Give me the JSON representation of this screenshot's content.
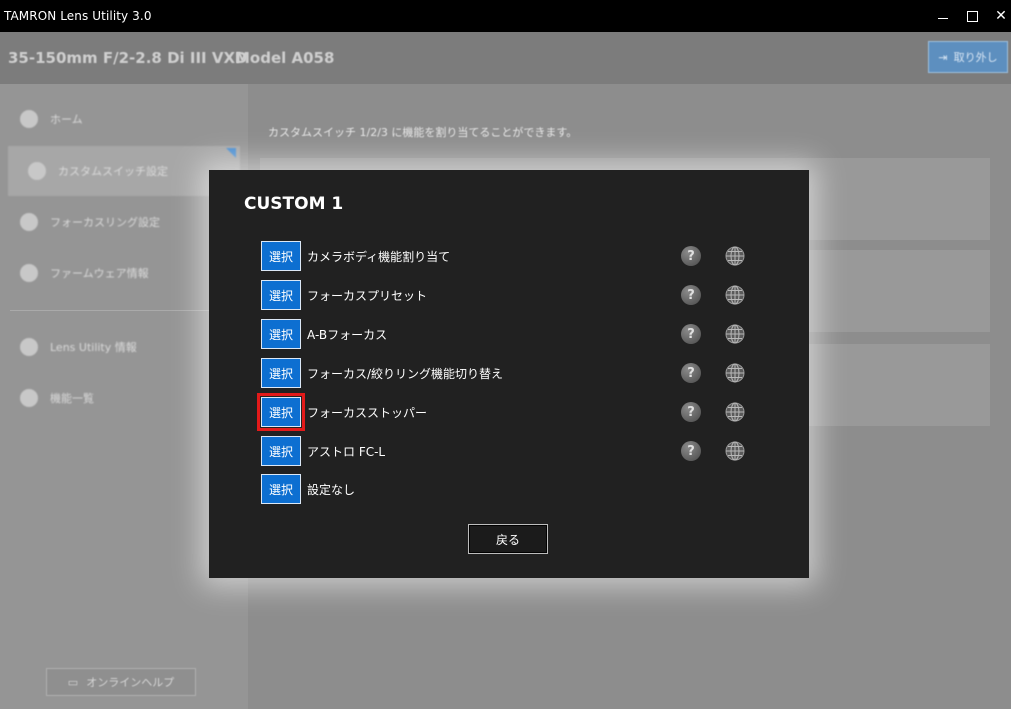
{
  "window": {
    "title": "TAMRON Lens Utility  3.0"
  },
  "header": {
    "lens_name": "35-150mm F/2-2.8 Di III VXD",
    "model": "Model A058",
    "detach_label": "取り外し"
  },
  "sidebar": {
    "items": [
      {
        "label": "ホーム",
        "icon": "home-icon"
      },
      {
        "label": "カスタムスイッチ設定",
        "icon": "switch-icon"
      },
      {
        "label": "フォーカスリング設定",
        "icon": "ring-icon"
      },
      {
        "label": "ファームウェア情報",
        "icon": "firmware-icon"
      },
      {
        "label": "Lens Utility 情報",
        "icon": "info-icon"
      },
      {
        "label": "機能一覧",
        "icon": "list-icon"
      }
    ],
    "help_label": "オンラインヘルプ"
  },
  "content": {
    "intro": "カスタムスイッチ 1/2/3 に機能を割り当てることができます。"
  },
  "modal": {
    "title": "CUSTOM 1",
    "select_label": "選択",
    "options": [
      {
        "label": "カメラボディ機能割り当て",
        "has_help": true
      },
      {
        "label": "フォーカスプリセット",
        "has_help": true
      },
      {
        "label": "A-Bフォーカス",
        "has_help": true
      },
      {
        "label": "フォーカス/絞りリング機能切り替え",
        "has_help": true
      },
      {
        "label": "フォーカスストッパー",
        "has_help": true
      },
      {
        "label": "アストロ FC-L",
        "has_help": true
      },
      {
        "label": "設定なし",
        "has_help": false
      }
    ],
    "back_label": "戻る"
  },
  "colors": {
    "accent_blue": "#0d6fd1",
    "highlight_red": "#e21a1a",
    "modal_bg": "#212121"
  }
}
